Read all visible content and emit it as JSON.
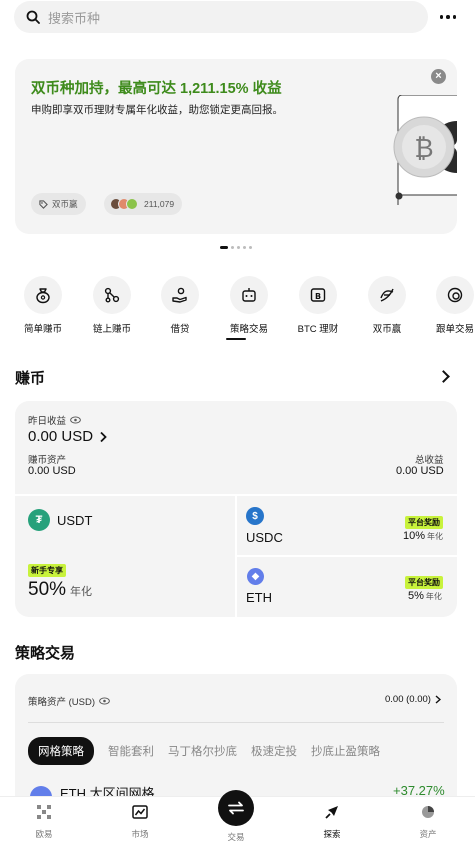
{
  "search": {
    "placeholder": "搜索币种"
  },
  "banner": {
    "title": "双币种加持，最高可达 1,211.15% 收益",
    "description": "申购即享双币理财专属年化收益，助您锁定更高回报。",
    "close": "×",
    "tag": "双币赢",
    "participants": "211,079",
    "page_count": 5,
    "active_page": 1
  },
  "categories": [
    {
      "label": "简单赚币",
      "icon": "money-bag-icon"
    },
    {
      "label": "链上赚币",
      "icon": "chain-nodes-icon"
    },
    {
      "label": "借贷",
      "icon": "loan-hand-icon"
    },
    {
      "label": "策略交易",
      "icon": "bot-icon"
    },
    {
      "label": "BTC 理财",
      "icon": "btc-card-icon"
    },
    {
      "label": "双币赢",
      "icon": "dual-coin-icon"
    },
    {
      "label": "跟单交易",
      "icon": "copy-trade-icon"
    }
  ],
  "earn": {
    "title": "赚币",
    "yesterday_label": "昨日收益",
    "yesterday_value": "0.00 USD",
    "assets_label": "赚币资产",
    "assets_value": "0.00 USD",
    "total_label": "总收益",
    "total_value": "0.00 USD",
    "usdt": {
      "name": "USDT",
      "badge": "新手专享",
      "apy": "50%",
      "apy_unit": "年化",
      "color": "#26a17b"
    },
    "usdc": {
      "name": "USDC",
      "badge": "平台奖励",
      "apy": "10%",
      "apy_unit": "年化",
      "color": "#2775ca"
    },
    "eth": {
      "name": "ETH",
      "badge": "平台奖励",
      "apy": "5%",
      "apy_unit": "年化",
      "color": "#627eea"
    }
  },
  "strategy": {
    "title": "策略交易",
    "assets_label": "策略资产 (USD)",
    "assets_value": "0.00 (0.00)",
    "tabs": [
      "网格策略",
      "智能套利",
      "马丁格尔抄底",
      "极速定投",
      "抄底止盈策略"
    ],
    "row_name": "ETH 大区间网格",
    "row_pct": "+37.27%"
  },
  "nav": {
    "items": [
      "欧易",
      "市场",
      "交易",
      "探索",
      "资产"
    ],
    "active": "探索"
  },
  "colors": {
    "accent_green": "#3e8b1c",
    "badge_green": "#c8f23c",
    "profit_green": "#2e8b2e"
  }
}
